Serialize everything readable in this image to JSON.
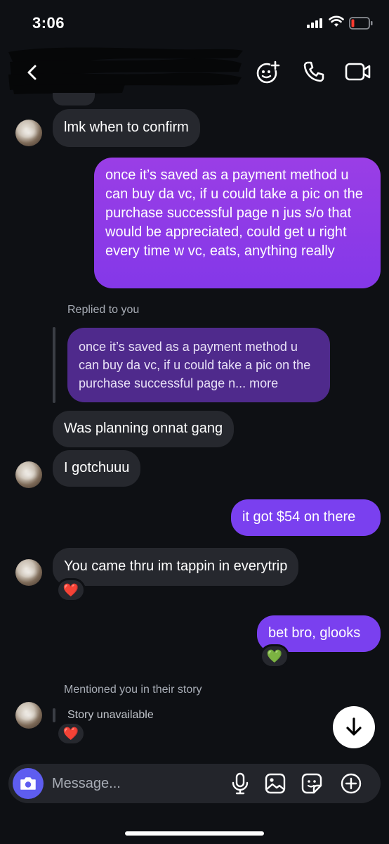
{
  "status_bar": {
    "time": "3:06"
  },
  "composer": {
    "placeholder": "Message..."
  },
  "messages": {
    "m1": "lmk when to confirm",
    "m2": "once it’s saved as a payment method u can buy da vc, if u could take a pic on the purchase successful page n jus s/o that would be appreciated, could get u right every time w vc, eats, anything really",
    "replied_label": "Replied to you",
    "quoted": "once it’s saved as a payment method u can buy da vc, if u could take a pic on the purchase successful page n... more",
    "m3": "Was planning onnat gang",
    "m4": "I gotchuuu",
    "m5": "it got $54 on there",
    "m6": "You came thru im tappin in everytrip",
    "m7": "bet bro, glooks",
    "story_label": "Mentioned you in their story",
    "story_unavailable": "Story unavailable"
  },
  "reactions": {
    "r1": "❤️",
    "r2": "💚",
    "r3": "❤️"
  },
  "colors": {
    "accent": "#8d34e6",
    "background": "#0e1014",
    "incoming": "#26282e",
    "camera": "#5e5df0"
  }
}
